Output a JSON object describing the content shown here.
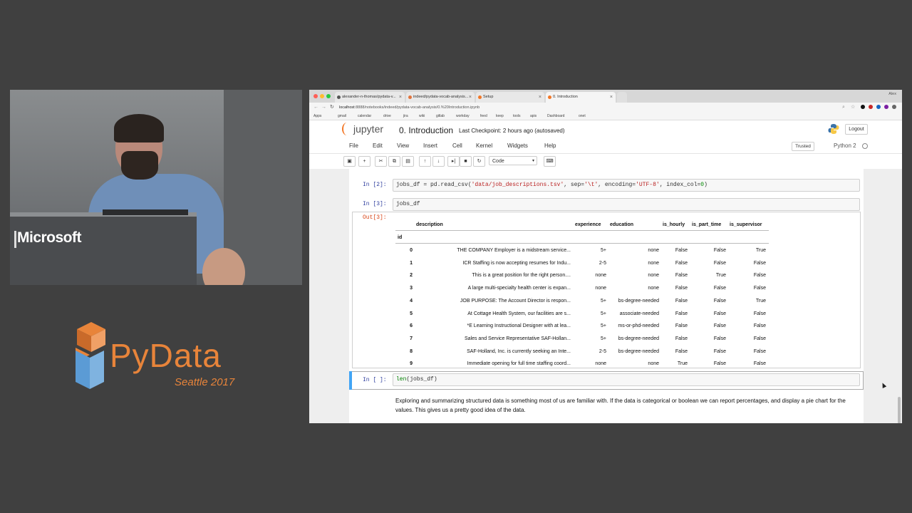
{
  "camera": {
    "brand": "Microsoft"
  },
  "pydata": {
    "word": "PyData",
    "subtitle": "Seattle 2017",
    "colors": {
      "accent": "#e8843a",
      "cube_blue": "#5b9bd5"
    }
  },
  "browser": {
    "tabs": [
      {
        "label": "alexander-n-thomas/pydata-v..."
      },
      {
        "label": "indeed/pydata-vocab-analysis..."
      },
      {
        "label": "Setup"
      },
      {
        "label": "0. Introduction"
      }
    ],
    "user": "Alex",
    "url_host": "localhost",
    "url_path": ":8888/notebooks/indeed/pydata-vocab-analysis/0.%20Introduction.ipynb",
    "bookmarks": [
      "Apps",
      "gmail",
      "calendar",
      "drive",
      "jira",
      "wiki",
      "gitlab",
      "workday",
      "feed",
      "keep",
      "tools",
      "apis",
      "Dashboard",
      "onet"
    ]
  },
  "jupyter": {
    "logo_text": "jupyter",
    "notebook_title": "0. Introduction",
    "checkpoint": "Last Checkpoint: 2 hours ago (autosaved)",
    "logout_label": "Logout",
    "menu": [
      "File",
      "Edit",
      "View",
      "Insert",
      "Cell",
      "Kernel",
      "Widgets",
      "Help"
    ],
    "trusted_label": "Trusted",
    "kernel_name": "Python 2",
    "cell_type": "Code"
  },
  "cells": {
    "c2": {
      "prompt": "In [2]:",
      "code_a": "jobs_df = pd.read_csv(",
      "code_s1": "'data/job_descriptions.tsv'",
      "code_b": ", sep=",
      "code_s2": "'\\t'",
      "code_c": ", encoding=",
      "code_s3": "'UTF-8'",
      "code_d": ", index_col=",
      "code_n": "0",
      "code_e": ")"
    },
    "c3": {
      "prompt": "In [3]:",
      "code": "jobs_df",
      "out_prompt": "Out[3]:"
    },
    "c4": {
      "prompt": "In [ ]:",
      "code_fn": "len",
      "code_rest": "(jobs_df)"
    },
    "markdown": "Exploring and summarizing structured data is something most of us are familiar with. If the data is categorical or boolean we can report percentages, and display a pie chart for the values. This gives us a pretty good idea of the data."
  },
  "dataframe": {
    "index_name": "id",
    "columns": [
      "description",
      "experience",
      "education",
      "is_hourly",
      "is_part_time",
      "is_supervisor"
    ],
    "rows": [
      [
        "0",
        "THE COMPANY Employer is a midstream service...",
        "5+",
        "none",
        "False",
        "False",
        "True"
      ],
      [
        "1",
        "ICR Staffing is now accepting resumes for Indu...",
        "2-5",
        "none",
        "False",
        "False",
        "False"
      ],
      [
        "2",
        "This is a great position for the right person....",
        "none",
        "none",
        "False",
        "True",
        "False"
      ],
      [
        "3",
        "A large multi-specialty health center is expan...",
        "none",
        "none",
        "False",
        "False",
        "False"
      ],
      [
        "4",
        "JOB PURPOSE: The Account Director is respon...",
        "5+",
        "bs-degree-needed",
        "False",
        "False",
        "True"
      ],
      [
        "5",
        "At Cottage Health System, our facilities are s...",
        "5+",
        "associate-needed",
        "False",
        "False",
        "False"
      ],
      [
        "6",
        "*E Learning Instructional Designer with at lea...",
        "5+",
        "ms-or-phd-needed",
        "False",
        "False",
        "False"
      ],
      [
        "7",
        "Sales and Service Representative SAF-Hollan...",
        "5+",
        "bs-degree-needed",
        "False",
        "False",
        "False"
      ],
      [
        "8",
        "SAF-Holland, Inc. is currently seeking an Inte...",
        "2-5",
        "bs-degree-needed",
        "False",
        "False",
        "False"
      ],
      [
        "9",
        "Immediate opening for full time staffing coord...",
        "none",
        "none",
        "True",
        "False",
        "False"
      ]
    ]
  }
}
